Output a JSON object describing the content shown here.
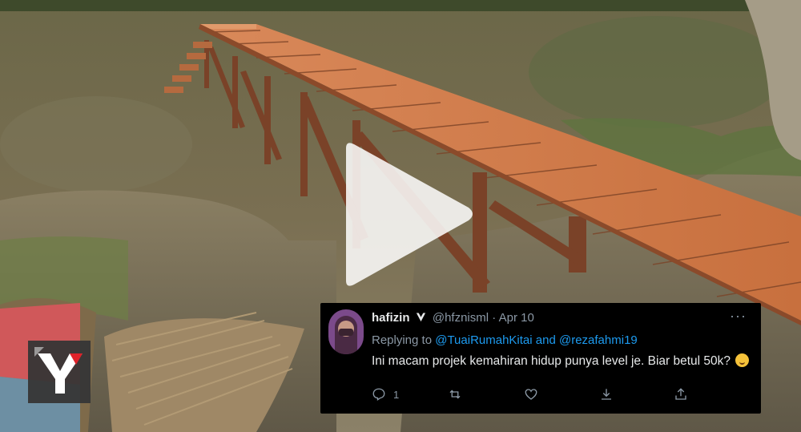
{
  "tweet": {
    "display_name": "hafizin",
    "handle": "@hfznisml",
    "separator": "·",
    "date": "Apr 10",
    "replying_prefix": "Replying to",
    "mention_1": "@TuaiRumahKitai",
    "conjunction": "and",
    "mention_2": "@rezafahmi19",
    "text": "Ini macam projek kemahiran hidup punya level je. Biar betul 50k?",
    "reply_count": "1",
    "more_label": "···"
  },
  "icons": [
    "verified-icon",
    "reply-icon",
    "retweet-icon",
    "like-icon",
    "share-down-icon",
    "share-up-icon",
    "play-icon",
    "brand-logo"
  ],
  "colors": {
    "tweet_bg": "#000000",
    "link": "#1d9bf0",
    "muted": "#8b98a5",
    "text": "#e7e9ea",
    "verified": "#e7e9ea",
    "plank": "#c86a3b"
  }
}
